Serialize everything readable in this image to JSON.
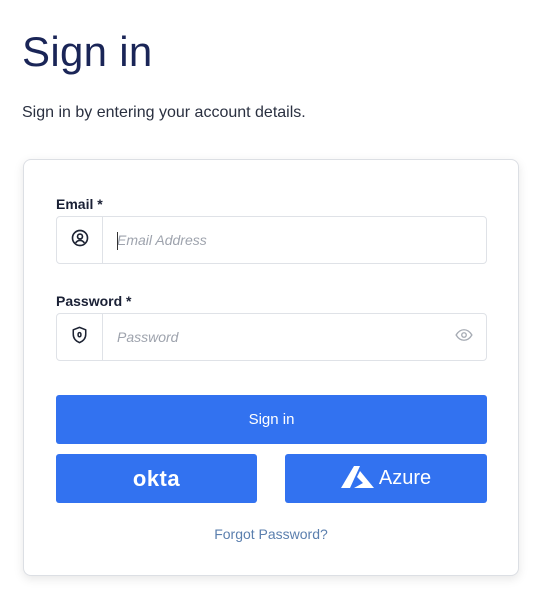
{
  "header": {
    "title": "Sign in",
    "subtitle": "Sign in by entering your account details."
  },
  "form": {
    "email": {
      "label": "Email *",
      "placeholder": "Email Address",
      "value": "",
      "prefix_icon": "user-circle-icon"
    },
    "password": {
      "label": "Password *",
      "placeholder": "Password",
      "value": "",
      "prefix_icon": "shield-icon",
      "suffix_icon": "eye-icon"
    },
    "sign_in_label": "Sign in",
    "okta_label": "okta",
    "azure_label": "Azure",
    "forgot_password_label": "Forgot Password?"
  },
  "colors": {
    "primary": "#3272f0",
    "title": "#1a2557",
    "link": "#5b7fae"
  }
}
